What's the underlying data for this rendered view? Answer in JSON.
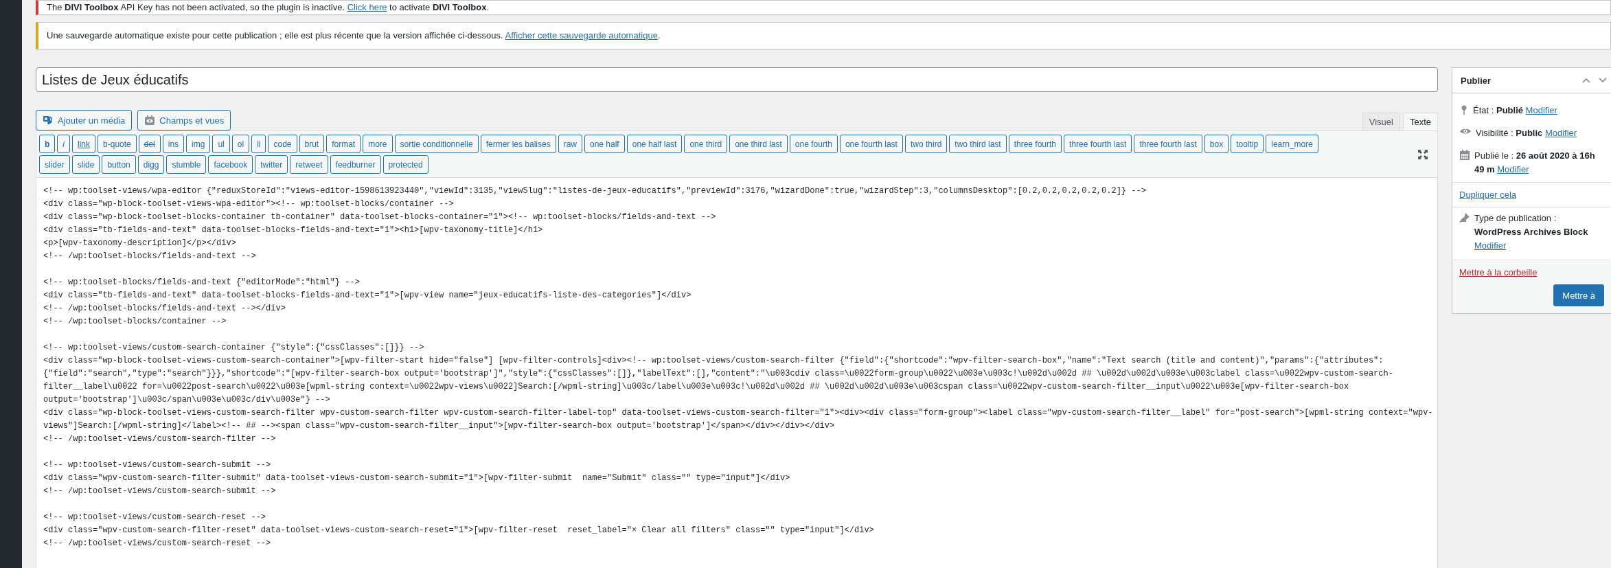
{
  "notices": [
    {
      "kind": "error",
      "before": "The **DIVI Toolbox** API Key has not been activated, so the plugin is inactive. ",
      "link": "Click here",
      "after": " to activate **DIVI Toolbox**."
    },
    {
      "kind": "warning",
      "before": "Une sauvegarde automatique existe pour cette publication ; elle est plus récente que la version affichée ci-dessous. ",
      "link": "Afficher cette sauvegarde automatique",
      "after": "."
    }
  ],
  "title": {
    "value": "Listes de Jeux éducatifs"
  },
  "media_buttons": [
    {
      "kind": "media",
      "label": "Ajouter un média"
    },
    {
      "kind": "fields",
      "label": "Champs et vues"
    }
  ],
  "editor_tabs": [
    {
      "label": "Visuel",
      "selected": false
    },
    {
      "label": "Texte",
      "selected": true
    }
  ],
  "quicktag_rows": [
    [
      {
        "label": "b",
        "kind": "bold"
      },
      {
        "label": "i",
        "kind": "italic"
      },
      {
        "label": "link",
        "kind": "link"
      },
      {
        "label": "b-quote",
        "kind": "plain"
      },
      {
        "label": "del",
        "kind": "strike"
      },
      {
        "label": "ins",
        "kind": "plain"
      },
      {
        "label": "img",
        "kind": "plain"
      },
      {
        "label": "ul",
        "kind": "plain"
      },
      {
        "label": "ol",
        "kind": "plain"
      },
      {
        "label": "li",
        "kind": "plain"
      },
      {
        "label": "code",
        "kind": "plain"
      },
      {
        "label": "brut",
        "kind": "plain"
      },
      {
        "label": "format",
        "kind": "plain"
      },
      {
        "label": "more",
        "kind": "plain"
      },
      {
        "label": "sortie conditionnelle",
        "kind": "plain"
      },
      {
        "label": "fermer les balises",
        "kind": "plain"
      },
      {
        "label": "raw",
        "kind": "plain"
      },
      {
        "label": "one half",
        "kind": "plain"
      },
      {
        "label": "one half last",
        "kind": "plain"
      },
      {
        "label": "one third",
        "kind": "plain"
      },
      {
        "label": "one third last",
        "kind": "plain"
      },
      {
        "label": "one fourth",
        "kind": "plain"
      },
      {
        "label": "one fourth last",
        "kind": "plain"
      },
      {
        "label": "two third",
        "kind": "plain"
      },
      {
        "label": "two third last",
        "kind": "plain"
      },
      {
        "label": "three fourth",
        "kind": "plain"
      },
      {
        "label": "three fourth last",
        "kind": "plain"
      },
      {
        "label": "three fourth last",
        "kind": "plain"
      },
      {
        "label": "box",
        "kind": "plain"
      },
      {
        "label": "tooltip",
        "kind": "plain"
      },
      {
        "label": "learn_more",
        "kind": "plain"
      }
    ],
    [
      {
        "label": "slider",
        "kind": "plain"
      },
      {
        "label": "slide",
        "kind": "plain"
      },
      {
        "label": "button",
        "kind": "plain"
      },
      {
        "label": "digg",
        "kind": "plain"
      },
      {
        "label": "stumble",
        "kind": "plain"
      },
      {
        "label": "facebook",
        "kind": "plain"
      },
      {
        "label": "twitter",
        "kind": "plain"
      },
      {
        "label": "retweet",
        "kind": "plain"
      },
      {
        "label": "feedburner",
        "kind": "plain"
      },
      {
        "label": "protected",
        "kind": "plain"
      }
    ]
  ],
  "code_blocks": [
    [
      "<!-- wp:toolset-views/wpa-editor {\"reduxStoreId\":\"views-editor-1598613923440\",\"viewId\":3135,\"viewSlug\":\"listes-de-jeux-educatifs\",\"previewId\":3176,\"wizardDone\":true,\"wizardStep\":3,\"columnsDesktop\":[0.2,0.2,0.2,0.2,0.2]} -->",
      "<div class=\"wp-block-toolset-views-wpa-editor\"><!-- wp:toolset-blocks/container -->",
      "<div class=\"wp-block-toolset-blocks-container tb-container\" data-toolset-blocks-container=\"1\"><!-- wp:toolset-blocks/fields-and-text -->",
      "<div class=\"tb-fields-and-text\" data-toolset-blocks-fields-and-text=\"1\"><h1>[wpv-taxonomy-title]</h1>",
      "<p>[wpv-taxonomy-description]</p></div>",
      "<!-- /wp:toolset-blocks/fields-and-text -->"
    ],
    [
      "<!-- wp:toolset-blocks/fields-and-text {\"editorMode\":\"html\"} -->",
      "<div class=\"tb-fields-and-text\" data-toolset-blocks-fields-and-text=\"1\">[wpv-view name=\"jeux-educatifs-liste-des-categories\"]</div>",
      "<!-- /wp:toolset-blocks/fields-and-text --></div>",
      "<!-- /wp:toolset-blocks/container -->"
    ],
    [
      "<!-- wp:toolset-views/custom-search-container {\"style\":{\"cssClasses\":[]}} -->",
      "<div class=\"wp-block-toolset-views-custom-search-container\">[wpv-filter-start hide=\"false\"] [wpv-filter-controls]<div><!-- wp:toolset-views/custom-search-filter {\"field\":{\"shortcode\":\"wpv-filter-search-box\",\"name\":\"Text search (title and content)\",\"params\":{\"attributes\":",
      "{\"field\":\"search\",\"type\":\"search\"}}},\"shortcode\":\"[wpv-filter-search-box output='bootstrap']\",\"style\":{\"cssClasses\":[]},\"labelText\":[],\"content\":\"\\u003cdiv class=\\u0022form-group\\u0022\\u003e\\u003c!\\u002d\\u002d ## \\u002d\\u002d\\u003e\\u003clabel class=\\u0022wpv-custom-search-",
      "filter__label\\u0022 for=\\u0022post-search\\u0022\\u003e[wpml-string context=\\u0022wpv-views\\u0022]Search:[/wpml-string]\\u003c/label\\u003e\\u003c!\\u002d\\u002d ## \\u002d\\u002d\\u003e\\u003cspan class=\\u0022wpv-custom-search-filter__input\\u0022\\u003e[wpv-filter-search-box",
      "output='bootstrap']\\u003c/span\\u003e\\u003c/div\\u003e\"} -->",
      "<div class=\"wp-block-toolset-views-custom-search-filter wpv-custom-search-filter wpv-custom-search-filter-label-top\" data-toolset-views-custom-search-filter=\"1\"><div><div class=\"form-group\"><label class=\"wpv-custom-search-filter__label\" for=\"post-search\">[wpml-string context=\"wpv-",
      "views\"]Search:[/wpml-string]</label><!-- ## --><span class=\"wpv-custom-search-filter__input\">[wpv-filter-search-box output='bootstrap']</span></div></div></div>",
      "<!-- /wp:toolset-views/custom-search-filter -->"
    ],
    [
      "<!-- wp:toolset-views/custom-search-submit -->",
      "<div class=\"wpv-custom-search-filter-submit\" data-toolset-views-custom-search-submit=\"1\">[wpv-filter-submit  name=\"Submit\" class=\"\" type=\"input\"]</div>",
      "<!-- /wp:toolset-views/custom-search-submit -->"
    ],
    [
      "<!-- wp:toolset-views/custom-search-reset -->",
      "<div class=\"wpv-custom-search-filter-reset\" data-toolset-views-custom-search-reset=\"1\">[wpv-filter-reset  reset_label=\"× Clear all filters\" class=\"\" type=\"input\"]</div>",
      "<!-- /wp:toolset-views/custom-search-reset -->"
    ]
  ],
  "publish_box": {
    "title": "Publier",
    "items": [
      {
        "kind": "status",
        "label": "État :",
        "value": "Publié",
        "link": "Modifier"
      },
      {
        "kind": "visibility",
        "label": "Visibilité :",
        "value": "Public",
        "link": "Modifier"
      },
      {
        "kind": "date",
        "label": "Publié le :",
        "value": "26 août 2020 à 16h 49 m",
        "link": "Modifier"
      }
    ],
    "duplicate_link": "Dupliquer cela",
    "post_type": {
      "label": "Type de publication :",
      "value": "WordPress Archives Block",
      "link": "Modifier"
    },
    "trash_link": "Mettre à la corbeille",
    "publish_button": "Mettre à"
  }
}
